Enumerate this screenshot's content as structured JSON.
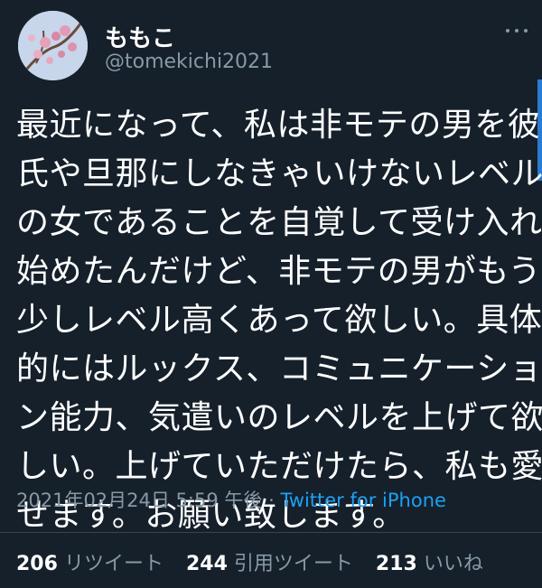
{
  "tweet": {
    "display_name": "ももこ",
    "handle": "@tomekichi2021",
    "text_lines": [
      "最近になって、私は非モテの男を彼",
      "氏や旦那にしなきゃいけないレベル",
      "の女であることを自覚して受け入れ",
      "始めたんだけど、非モテの男がもう",
      "少しレベル高くあって欲しい。具体",
      "的にはルックス、コミュニケーショ",
      "ン能力、気遣いのレベルを上げて欲",
      "しい。上げていただけたら、私も愛",
      "せます。お願い致します。"
    ],
    "timestamp": "2021年02月24日 5:59 午後",
    "separator": " · ",
    "source": "Twitter for iPhone",
    "stats": {
      "retweets_count": "206",
      "retweets_label": "リツイート",
      "quotes_count": "244",
      "quotes_label": "引用ツイート",
      "likes_count": "213",
      "likes_label": "いいね"
    }
  },
  "colors": {
    "background": "#15202b",
    "secondary_text": "#8899a6",
    "link": "#1da1f2"
  },
  "icons": {
    "more": "more-horizontal-icon"
  }
}
